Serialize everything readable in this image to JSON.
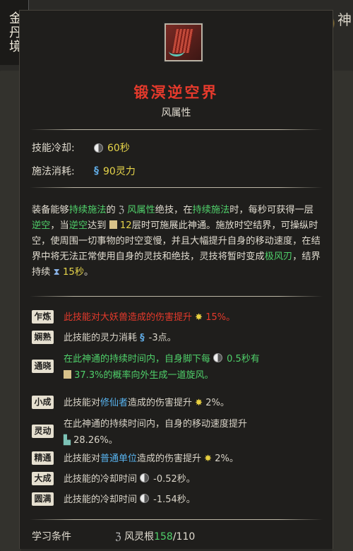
{
  "realm_tag": "金丹境",
  "corner_char": "神",
  "skill": {
    "name": "锻溟逆空界",
    "attribute": "风属性"
  },
  "stats": {
    "cooldown_label": "技能冷却:",
    "cooldown_value": "60秒",
    "cost_label": "施法消耗:",
    "cost_value": "90灵力"
  },
  "description": {
    "p1": "装备能够",
    "kw1": "持续施法",
    "p2": "的 ",
    "kw2": "风属性",
    "p3": "绝技，在",
    "kw3": "持续施法",
    "p4": "时，每秒可获得一层",
    "kw4": "逆空",
    "p5": "，当",
    "kw5": "逆空",
    "p6": "达到 ",
    "kw6": "12",
    "p7": "层时可施展此神通。施放时空结界，可操纵时空，使周围一切事物的时空变慢，并且大幅提升自身的移动速度，在结界中将无法正常使用自身的灵技和绝技，灵技将暂时变成",
    "kw7": "极风刃",
    "p8": "，结界持续 ",
    "kw8": "15秒",
    "p9": "。"
  },
  "upgrades": [
    {
      "tag": "乍炼",
      "text": "此技能对大妖兽造成的伤害提升 ",
      "value": "15%。"
    },
    {
      "tag": "娴熟",
      "text": "此技能的灵力消耗 ",
      "value": "-3点。"
    },
    {
      "tag": "通晓",
      "line1": "在此神通的持续时间内，自身脚下每 ",
      "line1_val": "0.5秒有",
      "line2": "37.3%的概率向外生成一道旋风。"
    },
    {
      "tag": "小成",
      "pre": "此技能对",
      "kw": "修仙者",
      "post": "造成的伤害提升 ",
      "value": "2%。"
    },
    {
      "tag": "灵动",
      "line1": "在此神通的持续时间内，自身的移动速度提升",
      "line2": "28.26%。"
    },
    {
      "tag": "精通",
      "pre": "此技能对",
      "kw": "普通单位",
      "post": "造成的伤害提升 ",
      "value": "2%。"
    },
    {
      "tag": "大成",
      "text": "此技能的冷却时间 ",
      "value": "-0.52秒。"
    },
    {
      "tag": "圆满",
      "text": "此技能的冷却时间 ",
      "value": "-1.54秒。"
    }
  ],
  "learn": {
    "label": "学习条件",
    "req": "风灵根",
    "current": "158",
    "required": "/110"
  },
  "colors": {
    "name_red": "#e63a2c",
    "keyword_green": "#4fd06a",
    "keyword_blue": "#58b4f0",
    "value_yellow": "#e6d44a"
  }
}
